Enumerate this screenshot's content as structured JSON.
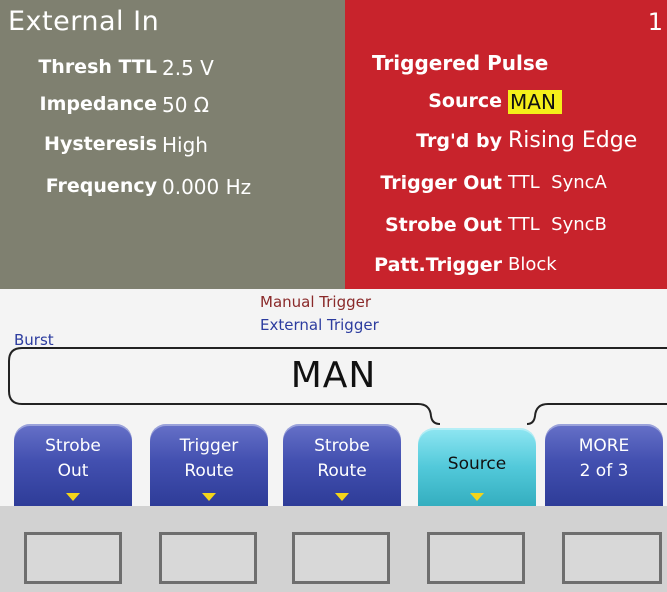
{
  "left_panel": {
    "title": "External In",
    "rows": [
      {
        "label": "Thresh TTL",
        "value": "2.5 V"
      },
      {
        "label": "Impedance",
        "value": "50 Ω"
      },
      {
        "label": "Hysteresis",
        "value": "High"
      },
      {
        "label": "Frequency",
        "value": "0.000 Hz"
      }
    ]
  },
  "right_panel": {
    "channel": "1",
    "title_part1": "Triggered",
    "title_part2": "Pulse",
    "rows": [
      {
        "label": "Source",
        "value": "MAN"
      },
      {
        "label": "Trg'd by",
        "value": "Rising Edge"
      },
      {
        "label": "Trigger Out",
        "value": "TTL  SyncA"
      },
      {
        "label": "Strobe Out",
        "value": "TTL  SyncB"
      },
      {
        "label": "Patt.Trigger",
        "value": "Block"
      }
    ],
    "highlight_color": "#f5ef1a",
    "background_color": "#c8232c"
  },
  "options": {
    "burst": "Burst",
    "manual": "Manual Trigger",
    "external": "External Trigger"
  },
  "value_box": {
    "value": "MAN"
  },
  "softkeys": [
    {
      "line1": "Strobe",
      "line2": "Out",
      "active": false
    },
    {
      "line1": "Trigger",
      "line2": "Route",
      "active": false
    },
    {
      "line1": "Strobe",
      "line2": "Route",
      "active": false
    },
    {
      "label": "Source",
      "active": true
    },
    {
      "line1": "MORE",
      "line2": "2 of 3",
      "active": false
    }
  ]
}
